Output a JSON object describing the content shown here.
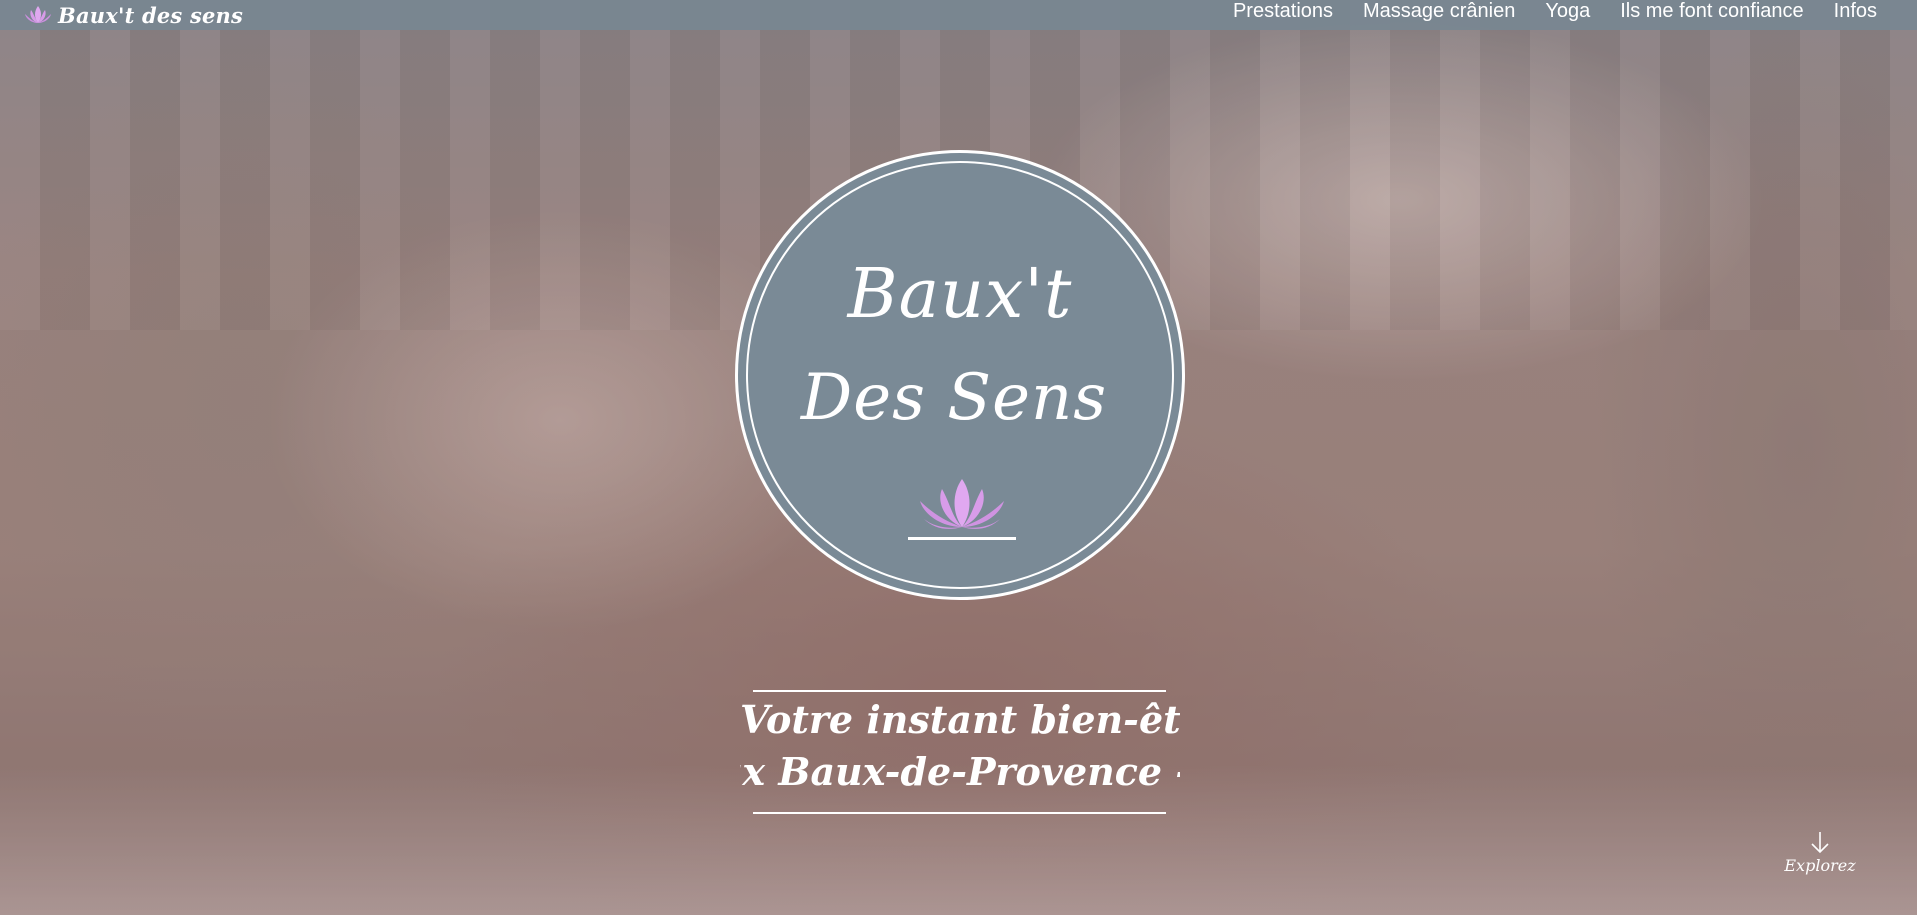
{
  "brand": {
    "name": "Baux't des sens",
    "icon": "lotus-icon"
  },
  "nav": {
    "items": [
      {
        "label": "Prestations"
      },
      {
        "label": "Massage crânien"
      },
      {
        "label": "Yoga"
      },
      {
        "label": "Ils me font confiance"
      },
      {
        "label": "Infos"
      }
    ]
  },
  "hero": {
    "logo_line1": "Baux't",
    "logo_line2": "Des Sens",
    "logo_icon": "lotus-icon",
    "tagline_line1": "Votre instant bien-être",
    "tagline_line2": "ıx Baux-de-Provence   -",
    "explore_label": "Explorez",
    "explore_icon": "arrow-down-icon"
  },
  "colors": {
    "header_bg": "#788791",
    "circle_bg": "#7a8a96",
    "lotus": "#e0a8f0",
    "text": "#ffffff"
  }
}
